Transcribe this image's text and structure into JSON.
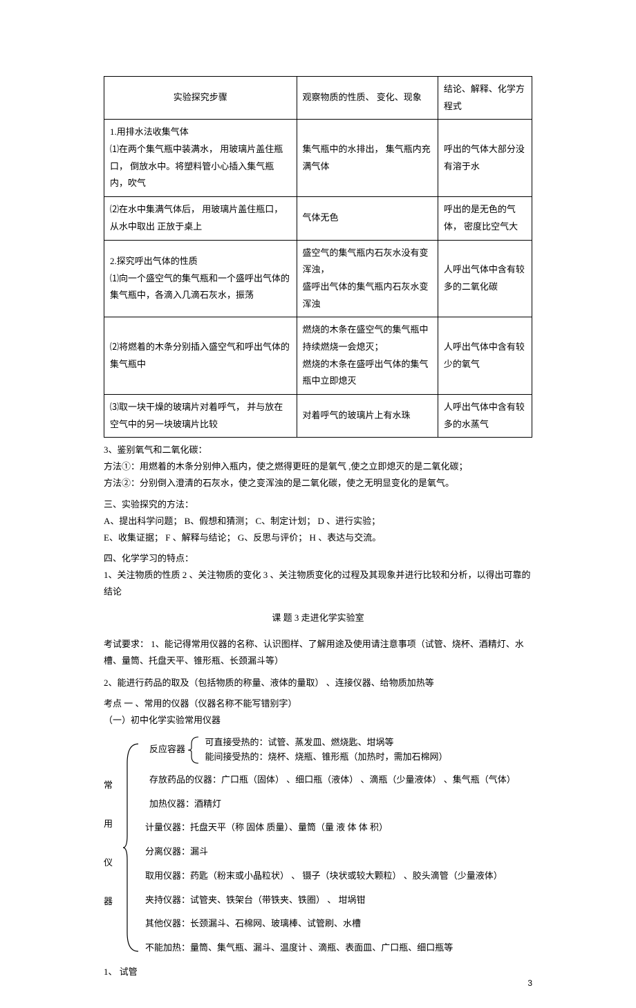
{
  "table": {
    "header": [
      "实验探究步骤",
      "观察物质的性质、  变化、现象",
      "结论、解释、化学方程式"
    ],
    "rows": [
      {
        "c1": "1.用排水法收集气体\n⑴在两个集气瓶中装满水，   用玻璃片盖住瓶口，   倒放水中。将塑料管小心插入集气瓶内，吹气",
        "c2": "集气瓶中的水排出，  集气瓶内充满气体",
        "c3": "呼出的气体大部分没有溶于水"
      },
      {
        "c1": "⑵在水中集满气体后，   用玻璃片盖住瓶口，   从水中取出 正放于桌上",
        "c2": "气体无色",
        "c3": "呼出的是无色的气体，  密度比空气大"
      },
      {
        "c1": " 2.探究呼出气体的性质\n⑴向一个盛空气的集气瓶和一个盛呼出气体的集气瓶中，各滴入几滴石灰水，振荡",
        "c2": "盛空气的集气瓶内石灰水没有变浑浊，\n盛呼出气体的集气瓶内石灰水变浑浊",
        "c3": "人呼出气体中含有较多的二氧化碳"
      },
      {
        "c1": "⑵将燃着的木条分别插入盛空气和呼出气体的集气瓶中",
        "c2": "燃烧的木条在盛空气的集气瓶中持续燃烧一会熄灭；\n燃烧的木条在盛呼出气体的集气瓶中立即熄灭",
        "c3": "人呼出气体中含有较少的氧气"
      },
      {
        "c1": "⑶取一块干燥的玻璃片对着呼气，   并与放在空气中的另一块玻璃片比较",
        "c2": "对着呼气的玻璃片上有水珠",
        "c3": "人呼出气体中含有较多的水蒸气"
      }
    ]
  },
  "body": {
    "p3": "3、鉴别氧气和二氧化碳：",
    "p3a": "方法①：用燃着的木条分别伸入瓶内，使之燃得更旺的是氧气      ,使之立即熄灭的是二氧化碳；",
    "p3b": "方法②：分别倒入澄清的石灰水，使之变浑浊的是二氧化碳，使之无明显变化的是氧气。",
    "s3": "三、实验探究的方法：",
    "s3a": "A、提出科学问题；   B、假想和猜测；   C、制定计划；     D 、进行实验；",
    "s3b": "E、收集证据；     F 、解释与结论；   G、反思与评价；    H 、表达与交流。",
    "s4": "四、化学学习的特点：",
    "s4a": "1、关注物质的性质     2  、关注物质的变化     3  、关注物质变化的过程及其现象并进行比较和分析，以得出可靠的结论",
    "title": "课 题  3    走进化学实验室",
    "req": "考试要求：  1、能记得常用仪器的名称、认识图样、了解用途及使用请注意事项（试管、烧杯、酒精灯、水槽、量筒、托盘天平、锥形瓶、长颈漏斗等）",
    "req2": "2、能进行药品的取及（包括物质的称量、液体的量取）     、连接仪器、给物质加热等",
    "kp1": "考点 一 、常用的仪器（仪器名称不能写错别字）",
    "kp1a": "（一）初中化学实验常用仪器",
    "labels": {
      "a": "常",
      "b": "用",
      "c": "仪",
      "d": "器"
    },
    "br": {
      "r1_label": "反应容器",
      "r1a": "可直接受热的：试管、蒸发皿、燃烧匙、坩埚等",
      "r1b": "能间接受热的：烧杯、烧瓶、锥形瓶（加热时，需加石棉网）",
      "r2": "存放药品的仪器：广口瓶（固体）   、细口瓶（液体）  、滴瓶（少量液体）   、集气瓶（气体）",
      "r3": "加热仪器：酒精灯",
      "r4": "计量仪器：托盘天平（称   固体 质量）、量筒（量  液 体 体 积）",
      "r5": "分离仪器：漏斗",
      "r6": "取用仪器：药匙（粉末或小晶粒状）    、 镊子（块状或较大颗粒）   、胶头滴管（少量液体）",
      "r7": "夹持仪器：试管夹、铁架台（带铁夹、铁圈）    、  坩埚钳",
      "r8": "其他仪器：长颈漏斗、石棉网、玻璃棒、试管刷、水槽",
      "r9": "不能加热：量筒、集气瓶、漏斗、温度计 、滴瓶、表面皿、广口瓶、细口瓶等"
    },
    "last": "1、  试管"
  },
  "page_num": "3"
}
